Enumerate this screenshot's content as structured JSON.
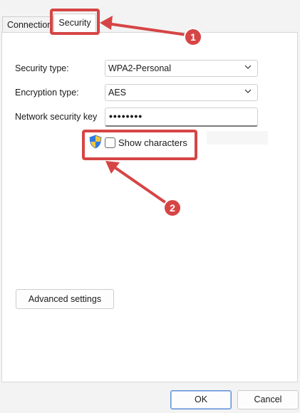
{
  "tabs": {
    "connection_label": "Connection",
    "security_label": "Security"
  },
  "form": {
    "security_type_label": "Security type:",
    "security_type_value": "WPA2-Personal",
    "encryption_type_label": "Encryption type:",
    "encryption_type_value": "AES",
    "network_key_label": "Network security key",
    "network_key_value": "••••••••",
    "show_characters_label": "Show characters",
    "show_characters_checked": false
  },
  "buttons": {
    "advanced_settings": "Advanced settings",
    "ok": "OK",
    "cancel": "Cancel"
  },
  "annotations": {
    "marker_1": "1",
    "marker_2": "2",
    "highlight_color": "#d64545"
  },
  "icons": [
    "chevron-down-icon",
    "uac-shield-icon"
  ]
}
